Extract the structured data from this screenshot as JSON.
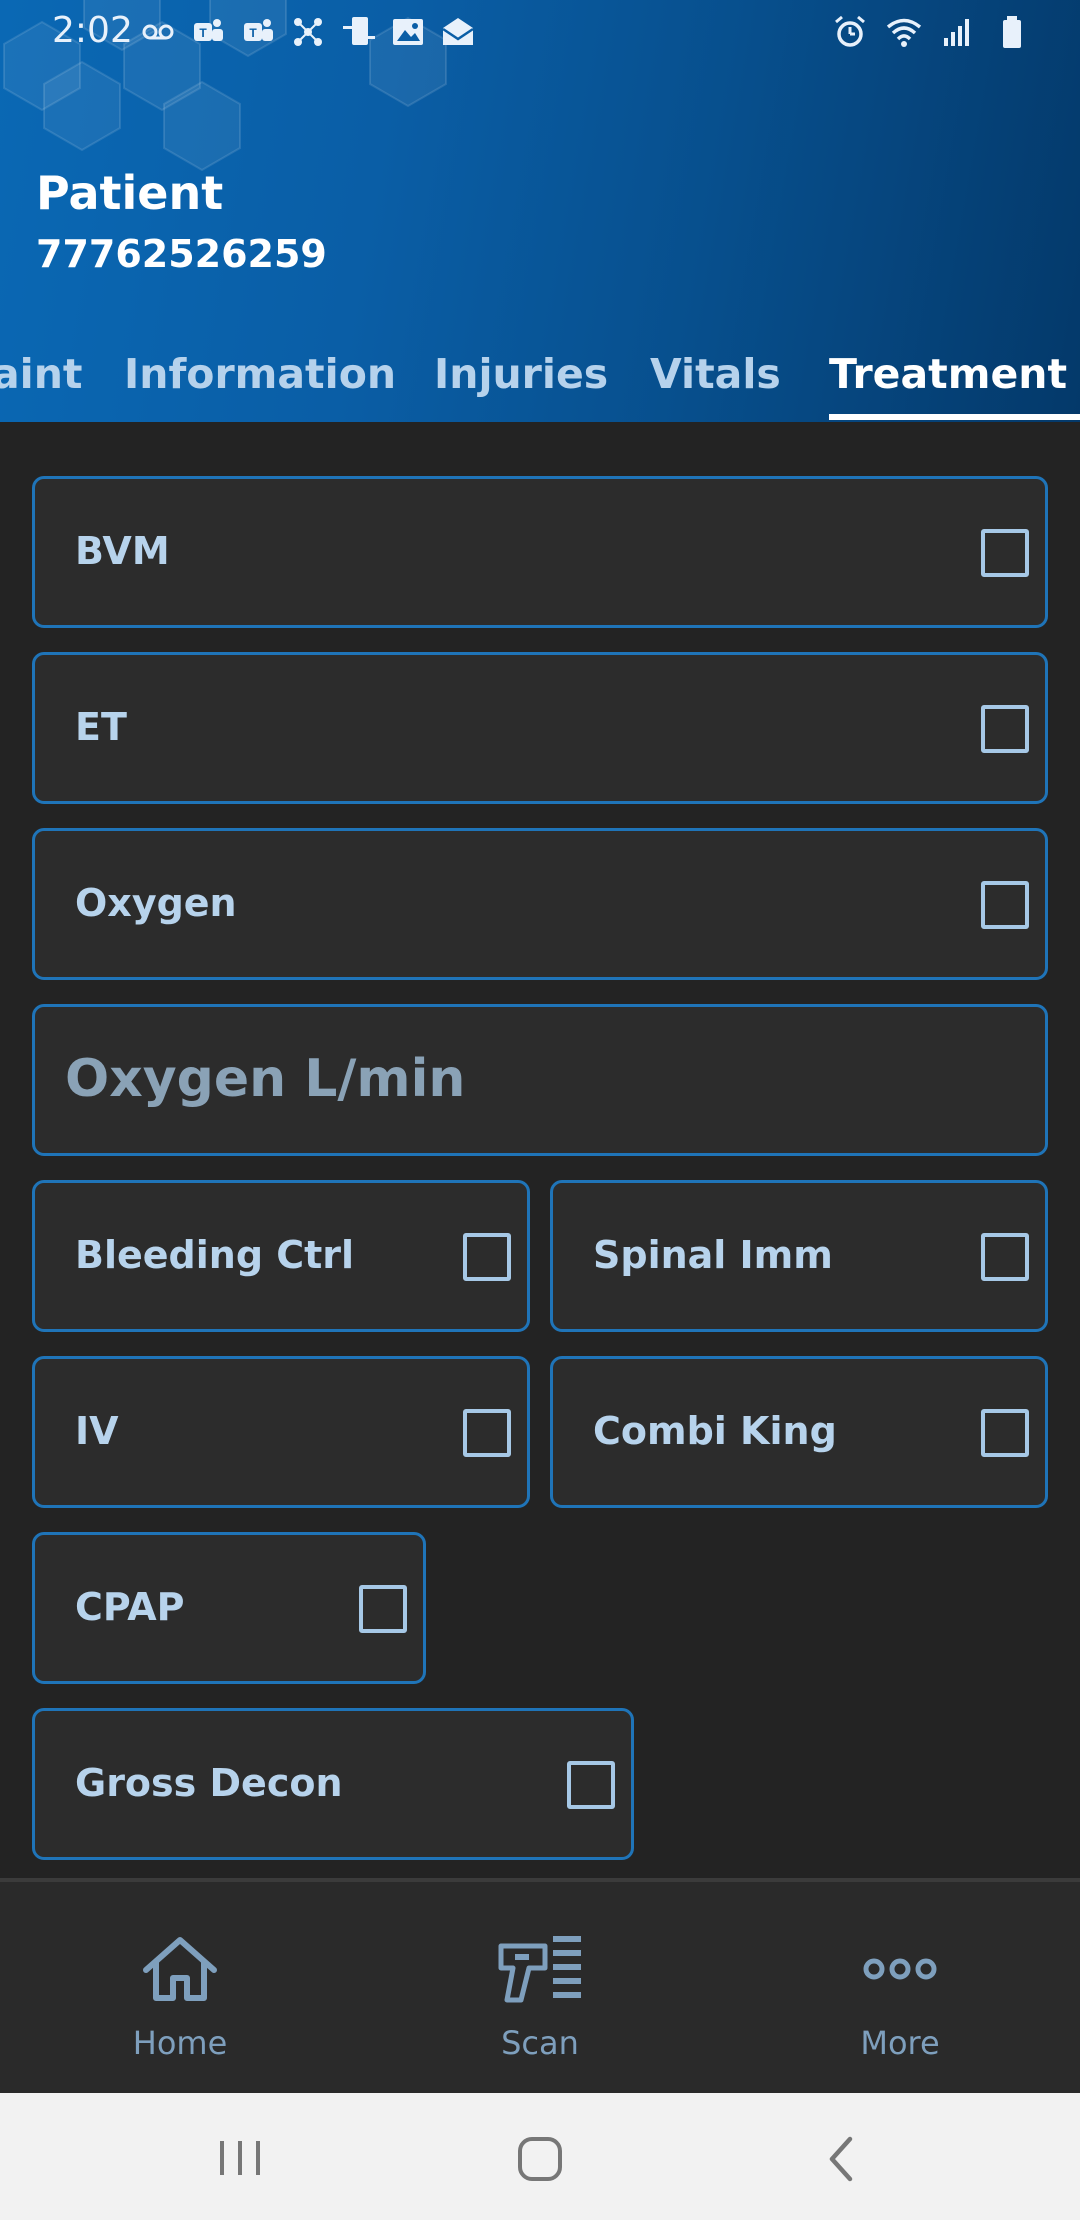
{
  "status_bar": {
    "time": "2:02",
    "left_icons": [
      "voicemail-icon",
      "teams-icon",
      "teams-icon",
      "network-icon",
      "phone-sync-icon",
      "image-icon",
      "mail-icon"
    ],
    "right_icons": [
      "alarm-icon",
      "wifi-icon",
      "signal-icon",
      "battery-icon"
    ]
  },
  "header": {
    "title": "Patient",
    "patient_id": "77762526259"
  },
  "tabs": [
    {
      "label": "aint",
      "active": false
    },
    {
      "label": "Information",
      "active": false
    },
    {
      "label": "Injuries",
      "active": false
    },
    {
      "label": "Vitals",
      "active": false
    },
    {
      "label": "Treatment",
      "active": true
    }
  ],
  "treatments": {
    "bvm": {
      "label": "BVM",
      "checked": false
    },
    "et": {
      "label": "ET",
      "checked": false
    },
    "oxygen": {
      "label": "Oxygen",
      "checked": false
    },
    "oxygen_rate": {
      "placeholder": "Oxygen L/min",
      "value": ""
    },
    "bleeding_ctrl": {
      "label": "Bleeding Ctrl",
      "checked": false
    },
    "spinal_imm": {
      "label": "Spinal Imm",
      "checked": false
    },
    "iv": {
      "label": "IV",
      "checked": false
    },
    "combi_king": {
      "label": "Combi King",
      "checked": false
    },
    "cpap": {
      "label": "CPAP",
      "checked": false
    },
    "gross_decon": {
      "label": "Gross Decon",
      "checked": false
    }
  },
  "bottom_nav": {
    "home": {
      "label": "Home",
      "icon": "home-icon"
    },
    "scan": {
      "label": "Scan",
      "icon": "scanner-icon"
    },
    "more": {
      "label": "More",
      "icon": "more-icon"
    }
  },
  "colors": {
    "header_start": "#0a68b4",
    "header_end": "#04396a",
    "card_border": "#1f74b8",
    "background": "#232323",
    "label": "#b7d3ec"
  }
}
